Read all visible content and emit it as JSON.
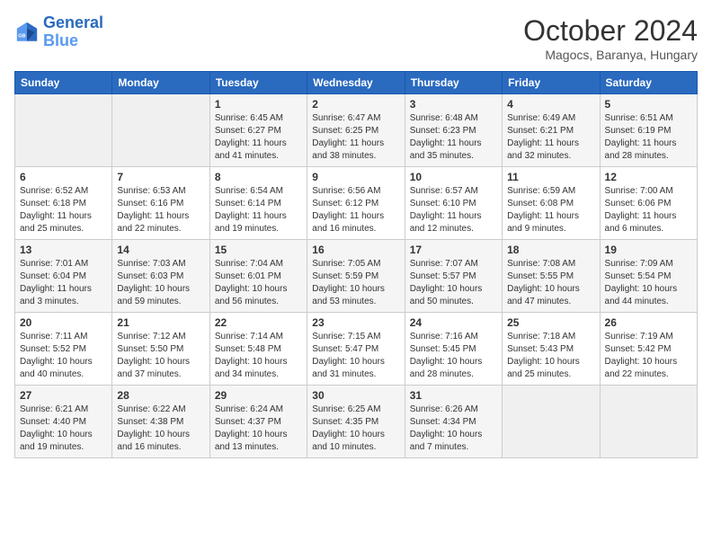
{
  "header": {
    "logo_line1": "General",
    "logo_line2": "Blue",
    "month_title": "October 2024",
    "subtitle": "Magocs, Baranya, Hungary"
  },
  "weekdays": [
    "Sunday",
    "Monday",
    "Tuesday",
    "Wednesday",
    "Thursday",
    "Friday",
    "Saturday"
  ],
  "weeks": [
    [
      {
        "day": "",
        "info": ""
      },
      {
        "day": "",
        "info": ""
      },
      {
        "day": "1",
        "info": "Sunrise: 6:45 AM\nSunset: 6:27 PM\nDaylight: 11 hours and 41 minutes."
      },
      {
        "day": "2",
        "info": "Sunrise: 6:47 AM\nSunset: 6:25 PM\nDaylight: 11 hours and 38 minutes."
      },
      {
        "day": "3",
        "info": "Sunrise: 6:48 AM\nSunset: 6:23 PM\nDaylight: 11 hours and 35 minutes."
      },
      {
        "day": "4",
        "info": "Sunrise: 6:49 AM\nSunset: 6:21 PM\nDaylight: 11 hours and 32 minutes."
      },
      {
        "day": "5",
        "info": "Sunrise: 6:51 AM\nSunset: 6:19 PM\nDaylight: 11 hours and 28 minutes."
      }
    ],
    [
      {
        "day": "6",
        "info": "Sunrise: 6:52 AM\nSunset: 6:18 PM\nDaylight: 11 hours and 25 minutes."
      },
      {
        "day": "7",
        "info": "Sunrise: 6:53 AM\nSunset: 6:16 PM\nDaylight: 11 hours and 22 minutes."
      },
      {
        "day": "8",
        "info": "Sunrise: 6:54 AM\nSunset: 6:14 PM\nDaylight: 11 hours and 19 minutes."
      },
      {
        "day": "9",
        "info": "Sunrise: 6:56 AM\nSunset: 6:12 PM\nDaylight: 11 hours and 16 minutes."
      },
      {
        "day": "10",
        "info": "Sunrise: 6:57 AM\nSunset: 6:10 PM\nDaylight: 11 hours and 12 minutes."
      },
      {
        "day": "11",
        "info": "Sunrise: 6:59 AM\nSunset: 6:08 PM\nDaylight: 11 hours and 9 minutes."
      },
      {
        "day": "12",
        "info": "Sunrise: 7:00 AM\nSunset: 6:06 PM\nDaylight: 11 hours and 6 minutes."
      }
    ],
    [
      {
        "day": "13",
        "info": "Sunrise: 7:01 AM\nSunset: 6:04 PM\nDaylight: 11 hours and 3 minutes."
      },
      {
        "day": "14",
        "info": "Sunrise: 7:03 AM\nSunset: 6:03 PM\nDaylight: 10 hours and 59 minutes."
      },
      {
        "day": "15",
        "info": "Sunrise: 7:04 AM\nSunset: 6:01 PM\nDaylight: 10 hours and 56 minutes."
      },
      {
        "day": "16",
        "info": "Sunrise: 7:05 AM\nSunset: 5:59 PM\nDaylight: 10 hours and 53 minutes."
      },
      {
        "day": "17",
        "info": "Sunrise: 7:07 AM\nSunset: 5:57 PM\nDaylight: 10 hours and 50 minutes."
      },
      {
        "day": "18",
        "info": "Sunrise: 7:08 AM\nSunset: 5:55 PM\nDaylight: 10 hours and 47 minutes."
      },
      {
        "day": "19",
        "info": "Sunrise: 7:09 AM\nSunset: 5:54 PM\nDaylight: 10 hours and 44 minutes."
      }
    ],
    [
      {
        "day": "20",
        "info": "Sunrise: 7:11 AM\nSunset: 5:52 PM\nDaylight: 10 hours and 40 minutes."
      },
      {
        "day": "21",
        "info": "Sunrise: 7:12 AM\nSunset: 5:50 PM\nDaylight: 10 hours and 37 minutes."
      },
      {
        "day": "22",
        "info": "Sunrise: 7:14 AM\nSunset: 5:48 PM\nDaylight: 10 hours and 34 minutes."
      },
      {
        "day": "23",
        "info": "Sunrise: 7:15 AM\nSunset: 5:47 PM\nDaylight: 10 hours and 31 minutes."
      },
      {
        "day": "24",
        "info": "Sunrise: 7:16 AM\nSunset: 5:45 PM\nDaylight: 10 hours and 28 minutes."
      },
      {
        "day": "25",
        "info": "Sunrise: 7:18 AM\nSunset: 5:43 PM\nDaylight: 10 hours and 25 minutes."
      },
      {
        "day": "26",
        "info": "Sunrise: 7:19 AM\nSunset: 5:42 PM\nDaylight: 10 hours and 22 minutes."
      }
    ],
    [
      {
        "day": "27",
        "info": "Sunrise: 6:21 AM\nSunset: 4:40 PM\nDaylight: 10 hours and 19 minutes."
      },
      {
        "day": "28",
        "info": "Sunrise: 6:22 AM\nSunset: 4:38 PM\nDaylight: 10 hours and 16 minutes."
      },
      {
        "day": "29",
        "info": "Sunrise: 6:24 AM\nSunset: 4:37 PM\nDaylight: 10 hours and 13 minutes."
      },
      {
        "day": "30",
        "info": "Sunrise: 6:25 AM\nSunset: 4:35 PM\nDaylight: 10 hours and 10 minutes."
      },
      {
        "day": "31",
        "info": "Sunrise: 6:26 AM\nSunset: 4:34 PM\nDaylight: 10 hours and 7 minutes."
      },
      {
        "day": "",
        "info": ""
      },
      {
        "day": "",
        "info": ""
      }
    ]
  ]
}
